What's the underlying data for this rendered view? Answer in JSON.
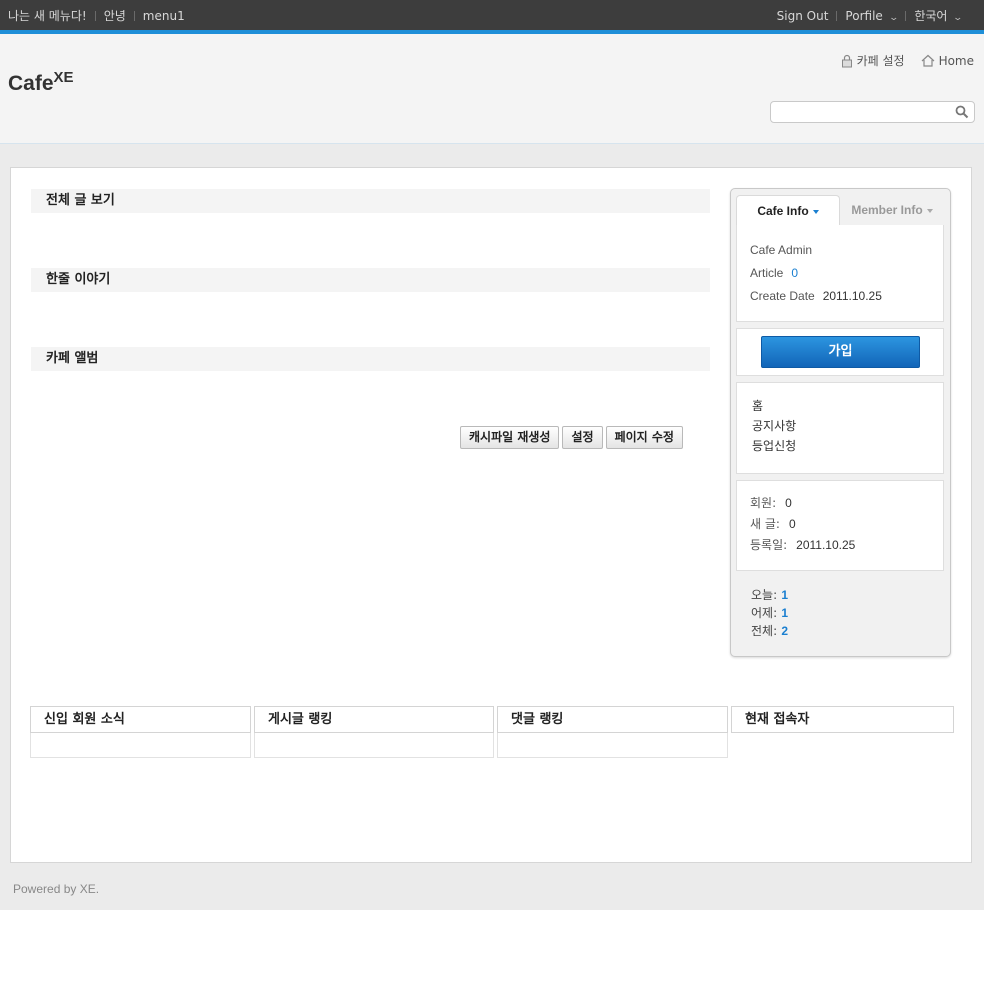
{
  "topbar": {
    "left_links": [
      "나는 새 메뉴다!",
      "안녕",
      "menu1"
    ],
    "sign_out": "Sign Out",
    "profile": "Porfile",
    "language": "한국어"
  },
  "header": {
    "logo": "Cafe",
    "logo_sup": "XE",
    "cafe_settings": "카페 설정",
    "home": "Home",
    "search_placeholder": ""
  },
  "main": {
    "sections": [
      "전체 글 보기",
      "한줄 이야기",
      "카페 앨범"
    ],
    "buttons": [
      "캐시파일 재생성",
      "설정",
      "페이지 수정"
    ]
  },
  "sidebar": {
    "tabs": {
      "cafe_info": "Cafe Info",
      "member_info": "Member Info"
    },
    "cafe_info": {
      "admin_label": "Cafe Admin",
      "article_label": "Article",
      "article_value": "0",
      "create_label": "Create Date",
      "create_value": "2011.10.25"
    },
    "join_button": "가입",
    "menu": [
      "홈",
      "공지사항",
      "등업신청"
    ],
    "stats": {
      "members_label": "회원:",
      "members_value": "0",
      "new_posts_label": "새 글:",
      "new_posts_value": "0",
      "registered_label": "등록일:",
      "registered_value": "2011.10.25"
    },
    "counter": {
      "today_label": "오늘:",
      "today_value": "1",
      "yesterday_label": "어제:",
      "yesterday_value": "1",
      "total_label": "전체:",
      "total_value": "2"
    }
  },
  "bottom": {
    "tables": [
      "신입 회원 소식",
      "게시글 랭킹",
      "댓글 랭킹",
      "현재 접속자"
    ]
  },
  "footer": {
    "text": "Powered by XE."
  },
  "colors": {
    "accent": "#1a7fd0",
    "topbar": "#3d3d3d",
    "topbar_border": "#1f8fd8"
  }
}
